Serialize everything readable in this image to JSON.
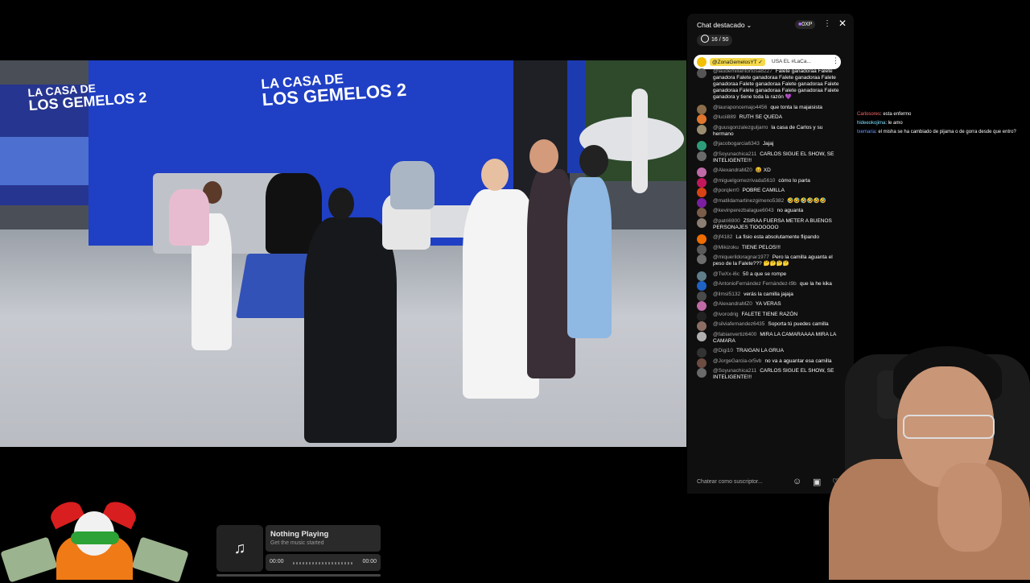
{
  "video": {
    "logo_line1": "LA CASA DE",
    "logo_line2": "LOS GEMELOS 2",
    "logo2_line1": "LA CASA DE",
    "logo2_line2": "LOS GEMELOS 2"
  },
  "chat": {
    "title": "Chat destacado",
    "xp_badge": "0XP",
    "counter": "16 / 50",
    "pinned": {
      "author": "@ZonaGemelosYT ✓",
      "text": "USA EL #LaCa..."
    },
    "messages": [
      {
        "author": "@laudemillantortosa8227",
        "text": "Falete ganadoraa Falete ganadora Falete ganadoraa Falete ganadoraa Falete ganadoraa Falete ganadoraa Falete ganadoraa Falete ganadoraa Falete ganadoraa Falete ganadoraa Falete ganadora y tiene toda la razón 💜",
        "color": "#555555"
      },
      {
        "author": "@lauraponcemajo4456",
        "text": "que tonta la majaisista",
        "color": "#8a6d4a"
      },
      {
        "author": "@lucii889",
        "text": "RUTH SE QUEDA",
        "color": "#e0762c"
      },
      {
        "author": "@guusgonzalezguljarro",
        "text": "la casa de Carlos y su hermano",
        "color": "#9a8c6e"
      },
      {
        "author": "@jacobogarcia6343",
        "text": "Jajaj",
        "color": "#2e9c7a"
      },
      {
        "author": "@Soyunachica211",
        "text": "CARLOS SIGUE EL SHOW, SE INTELIGENTE!!!",
        "color": "#6a6a6a"
      },
      {
        "author": "@AlexandraMZ0",
        "text": "😆 XD",
        "color": "#c06aa8"
      },
      {
        "author": "@miguelgomezrivada5610",
        "text": "cómo lo parta",
        "color": "#c2185b"
      },
      {
        "author": "@porqlerr0",
        "text": "POBRE CAMILLA",
        "color": "#d84315"
      },
      {
        "author": "@matildamartinezgimeno5382",
        "text": "🤣🤣🤣🤣🤣🤣",
        "color": "#7b1fa2"
      },
      {
        "author": "@kevinperezbalague6043",
        "text": "no aguanta",
        "color": "#7a5c4a"
      },
      {
        "author": "@patri6900",
        "text": "ZSIRAA FUERSA METER A BUENOS PERSONAJES TIOOOOOO",
        "color": "#8a7f72"
      },
      {
        "author": "@jf4182",
        "text": "La fisio esta absolutamente flipando",
        "color": "#ef6c00"
      },
      {
        "author": "@Mikizoku",
        "text": "TIENE PELOS!!!",
        "color": "#5a5a5a"
      },
      {
        "author": "@miquerildoragnar1977",
        "text": "Pero la camilla aguanta el peso de la Falete??? 🤔🤔🤔🤔",
        "color": "#6d6d6d"
      },
      {
        "author": "@TwXx-i6c",
        "text": "50 a que se rompe",
        "color": "#607d8b"
      },
      {
        "author": "@AntonioFernández Fernández-t9b",
        "text": "que la he kika",
        "color": "#1e63c4"
      },
      {
        "author": "@ilmsl5132",
        "text": "verás la camilla jajaja",
        "color": "#4a4a4a"
      },
      {
        "author": "@AlexandraMZ0",
        "text": "YA VERAS",
        "color": "#c06aa8"
      },
      {
        "author": "@ivorodrig",
        "text": "FALETE TIENE RAZÓN",
        "color": "#222222"
      },
      {
        "author": "@silviafernandez6435",
        "text": "Soporta tú puedes camilla",
        "color": "#8d6e63"
      },
      {
        "author": "@fabianvertiz6400",
        "text": "MIRA LA CAMARAAAA MIRA LA CAMARA",
        "color": "#b0b0b0"
      },
      {
        "author": "@Digi10",
        "text": "TRAIGAN LA GRUA",
        "color": "#333333"
      },
      {
        "author": "@JorgeGarcia-or5vb",
        "text": "no va a aguantar esa camilla",
        "color": "#6d4c41"
      },
      {
        "author": "@Soyunachica211",
        "text": "CARLOS SIGUE EL SHOW, SE INTELIGENTE!!!",
        "color": "#6a6a6a"
      }
    ],
    "input_placeholder": "Chatear como suscriptor..."
  },
  "side_messages": [
    {
      "user": "Carlosores",
      "text": ": esta enfermo",
      "color": "#ff6b6b"
    },
    {
      "user": "hideeokojima",
      "text": ": le amo",
      "color": "#7ee0ff"
    },
    {
      "user": "txemaria",
      "text": ": el misha se ha cambiado de pijama o de gorra desde que entro?",
      "color": "#6b9cff"
    }
  ],
  "music": {
    "title": "Nothing Playing",
    "subtitle": "Get the music started",
    "time_start": "00:00",
    "time_end": "00:00",
    "icon": "music-note-icon"
  }
}
